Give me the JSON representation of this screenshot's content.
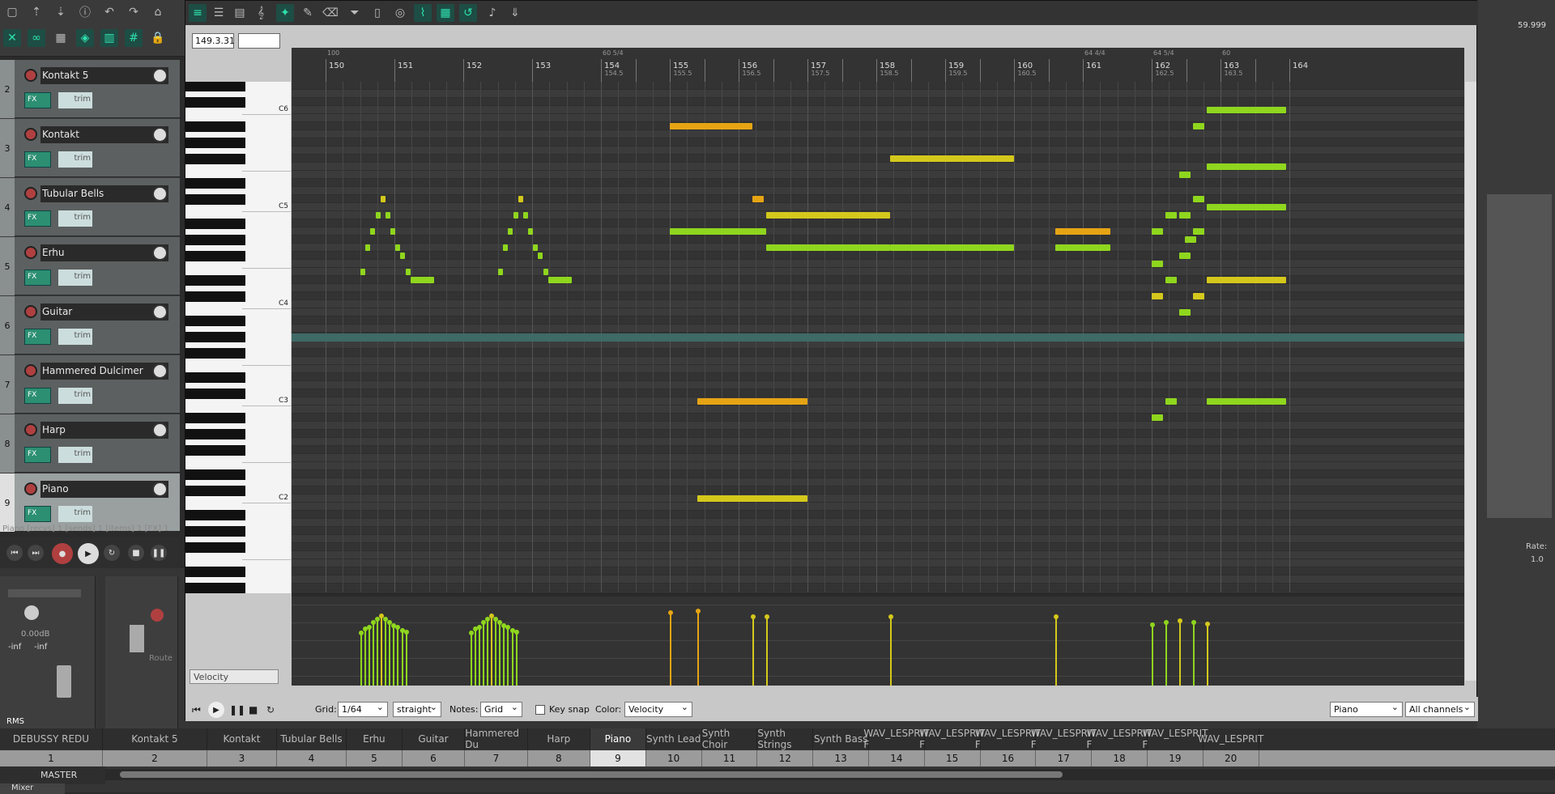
{
  "toolbar": {
    "icons": [
      "new-icon",
      "open-icon",
      "save-icon",
      "info-icon",
      "undo-icon",
      "redo-icon",
      "metronome-icon",
      "ripple-icon",
      "link-icon",
      "grid-icon",
      "group-icon",
      "snap-icon",
      "lock-icon"
    ]
  },
  "tracks": [
    {
      "num": "2",
      "name": "Kontakt 5"
    },
    {
      "num": "3",
      "name": "Kontakt"
    },
    {
      "num": "4",
      "name": "Tubular Bells"
    },
    {
      "num": "5",
      "name": "Erhu"
    },
    {
      "num": "6",
      "name": "Guitar"
    },
    {
      "num": "7",
      "name": "Hammered Dulcimer"
    },
    {
      "num": "8",
      "name": "Harp"
    },
    {
      "num": "9",
      "name": "Piano"
    }
  ],
  "track_labels": {
    "fx": "FX",
    "trim": "trim"
  },
  "track_info": "Piano [recvs] 1 [sends] 1 [items] 1 [FX] 1",
  "piano_roll": {
    "position": "149.3.31",
    "ruler_marks": [
      {
        "label": "150",
        "sub": "100"
      },
      {
        "label": "151"
      },
      {
        "label": "152"
      },
      {
        "label": "153"
      },
      {
        "label": "154",
        "sub": "60 5/4"
      },
      {
        "label": "154.5"
      },
      {
        "label": "155"
      },
      {
        "label": "155.5"
      },
      {
        "label": "156"
      },
      {
        "label": "156.5"
      },
      {
        "label": "157"
      },
      {
        "label": "157.5"
      },
      {
        "label": "158"
      },
      {
        "label": "158.5"
      },
      {
        "label": "159"
      },
      {
        "label": "159.5"
      },
      {
        "label": "160"
      },
      {
        "label": "160.5"
      },
      {
        "label": "161",
        "sub": "64 4/4"
      },
      {
        "label": "162",
        "sub": "64 5/4"
      },
      {
        "label": "162.5"
      },
      {
        "label": "163",
        "sub": "60"
      },
      {
        "label": "163.5"
      },
      {
        "label": "164"
      }
    ],
    "key_labels": [
      "C6",
      "C5",
      "C4",
      "C3",
      "C2"
    ],
    "lane_label": "Velocity",
    "bottom": {
      "grid_label": "Grid:",
      "grid_value": "1/64",
      "grid_type": "straight",
      "notes_label": "Notes:",
      "notes_value": "Grid",
      "keysnap_label": "Key snap",
      "color_label": "Color:",
      "color_value": "Velocity",
      "track_select": "Piano",
      "channel_select": "All channels"
    }
  },
  "bottom_tabs": [
    "DEBUSSY REDU",
    "Kontakt 5",
    "Kontakt",
    "Tubular Bells",
    "Erhu",
    "Guitar",
    "Hammered Du",
    "Harp",
    "Piano",
    "Synth Lead",
    "Synth Choir",
    "Synth Strings",
    "Synth Bass",
    "WAV_LESPRIT F",
    "WAV_LESPRIT F",
    "WAV_LESPRIT F",
    "WAV_LESPRIT F",
    "WAV_LESPRIT F",
    "WAV_LESPRIT F",
    "WAV_LESPRIT"
  ],
  "bottom_nums": [
    "1",
    "2",
    "3",
    "4",
    "5",
    "6",
    "7",
    "8",
    "9",
    "10",
    "11",
    "12",
    "13",
    "14",
    "15",
    "16",
    "17",
    "18",
    "19",
    "20"
  ],
  "master": "MASTER",
  "mixer_label": "Mixer",
  "mixer_text": {
    "rms": "RMS",
    "inf": "-inf",
    "db": "0.00dB",
    "route": "Route",
    "rate": "Rate:",
    "rate_val": "1.0",
    "time": "59.999"
  },
  "colors": {
    "accent": "#2ee0b0",
    "note_green": "#8fd61e",
    "note_yellow": "#d4c81c",
    "note_orange": "#e6a414"
  }
}
